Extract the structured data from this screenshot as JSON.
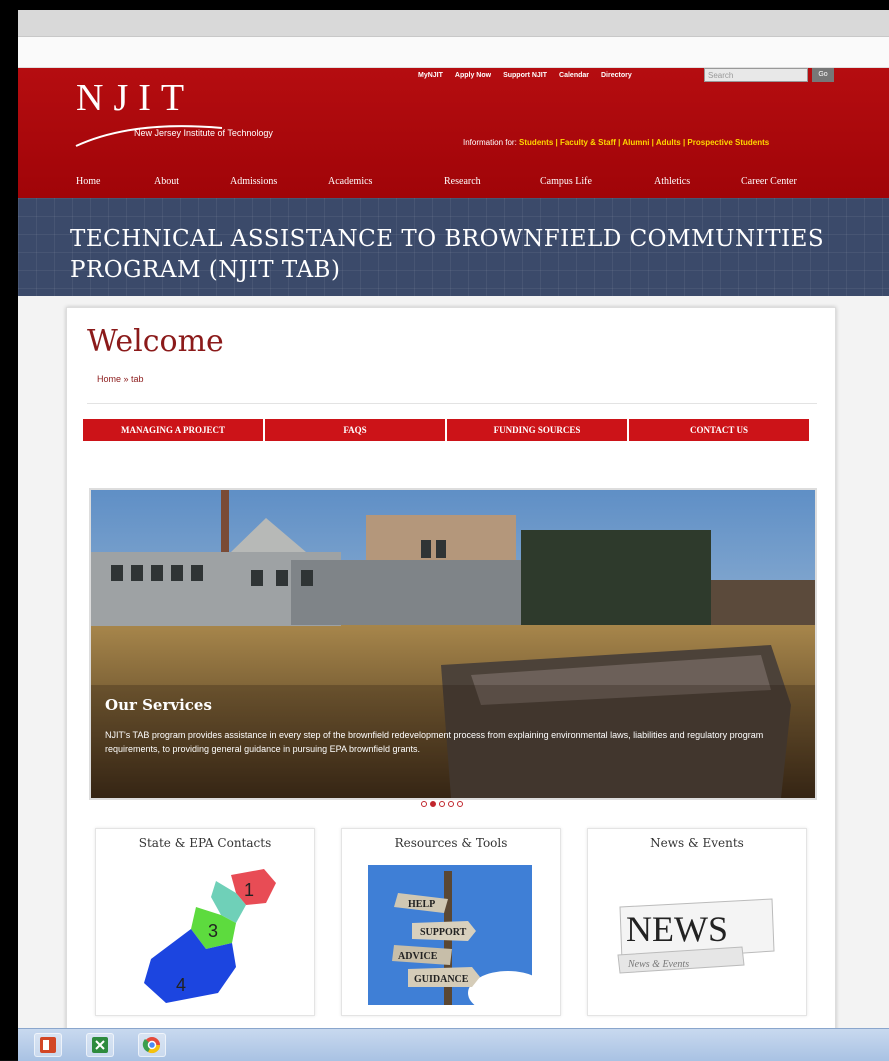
{
  "header": {
    "logo_text": "NJIT",
    "logo_subtitle": "New Jersey Institute of Technology",
    "top_links": [
      "MyNJIT",
      "Apply Now",
      "Support NJIT",
      "Calendar",
      "Directory"
    ],
    "search_placeholder": "Search",
    "search_button": "Go",
    "info_for_label": "Information for:",
    "info_for_links": "Students | Faculty & Staff | Alumni | Adults | Prospective Students",
    "nav": [
      "Home",
      "About",
      "Admissions",
      "Academics",
      "Research",
      "Campus Life",
      "Athletics",
      "Career Center"
    ]
  },
  "banner": {
    "title": "TECHNICAL ASSISTANCE TO BROWNFIELD COMMUNITIES PROGRAM (NJIT TAB)"
  },
  "content": {
    "heading": "Welcome",
    "breadcrumb": "Home » tab",
    "tabs": [
      "MANAGING A PROJECT",
      "FAQS",
      "FUNDING SOURCES",
      "CONTACT US"
    ],
    "slide": {
      "heading": "Our Services",
      "text": "NJIT's TAB program provides assistance in every step of the brownfield redevelopment process from explaining environmental laws, liabilities and regulatory program requirements, to providing general guidance in pursuing EPA brownfield grants."
    },
    "slide_dots": 5,
    "active_dot": 1,
    "boxes": [
      {
        "title": "State & EPA Contacts",
        "map_labels": [
          "1",
          "3",
          "4"
        ]
      },
      {
        "title": "Resources & Tools",
        "sign_labels": [
          "HELP",
          "SUPPORT",
          "ADVICE",
          "GUIDANCE"
        ]
      },
      {
        "title": "News & Events",
        "news_big": "NEWS",
        "news_small": "News & Events"
      }
    ]
  },
  "colors": {
    "brand_red": "#a5080b",
    "tab_red": "#cc1318",
    "banner_blue": "#3b4a6a",
    "gold": "#ffd700"
  }
}
